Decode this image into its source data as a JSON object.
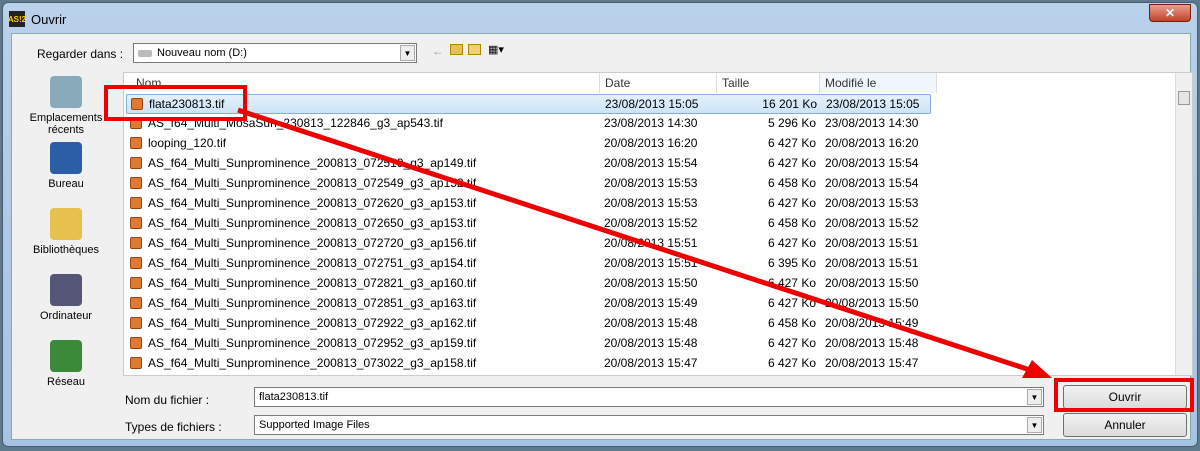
{
  "window": {
    "title": "Ouvrir",
    "logo": "AS!2",
    "close": "✕"
  },
  "lookin": {
    "label": "Regarder dans :",
    "value": "Nouveau nom (D:)"
  },
  "places": [
    {
      "label": "Emplacements récents",
      "icon": "recent-places-icon",
      "color": "#8ab"
    },
    {
      "label": "Bureau",
      "icon": "desktop-icon",
      "color": "#2a5fa8"
    },
    {
      "label": "Bibliothèques",
      "icon": "libraries-icon",
      "color": "#e8c050"
    },
    {
      "label": "Ordinateur",
      "icon": "computer-icon",
      "color": "#557"
    },
    {
      "label": "Réseau",
      "icon": "network-icon",
      "color": "#3a8a3a"
    }
  ],
  "columns": {
    "name": "Nom",
    "date": "Date",
    "size": "Taille",
    "modified": "Modifié le"
  },
  "files": [
    {
      "name": "flata230813.tif",
      "date": "23/08/2013 15:05",
      "size": "16 201 Ko",
      "modified": "23/08/2013 15:05",
      "selected": true
    },
    {
      "name": "AS_f64_Multi_MosaSun_230813_122846_g3_ap543.tif",
      "date": "23/08/2013 14:30",
      "size": "5 296 Ko",
      "modified": "23/08/2013 14:30"
    },
    {
      "name": "looping_120.tif",
      "date": "20/08/2013 16:20",
      "size": "6 427 Ko",
      "modified": "20/08/2013 16:20"
    },
    {
      "name": "AS_f64_Multi_Sunprominence_200813_072519_g3_ap149.tif",
      "date": "20/08/2013 15:54",
      "size": "6 427 Ko",
      "modified": "20/08/2013 15:54"
    },
    {
      "name": "AS_f64_Multi_Sunprominence_200813_072549_g3_ap152.tif",
      "date": "20/08/2013 15:53",
      "size": "6 458 Ko",
      "modified": "20/08/2013 15:54"
    },
    {
      "name": "AS_f64_Multi_Sunprominence_200813_072620_g3_ap153.tif",
      "date": "20/08/2013 15:53",
      "size": "6 427 Ko",
      "modified": "20/08/2013 15:53"
    },
    {
      "name": "AS_f64_Multi_Sunprominence_200813_072650_g3_ap153.tif",
      "date": "20/08/2013 15:52",
      "size": "6 458 Ko",
      "modified": "20/08/2013 15:52"
    },
    {
      "name": "AS_f64_Multi_Sunprominence_200813_072720_g3_ap156.tif",
      "date": "20/08/2013 15:51",
      "size": "6 427 Ko",
      "modified": "20/08/2013 15:51"
    },
    {
      "name": "AS_f64_Multi_Sunprominence_200813_072751_g3_ap154.tif",
      "date": "20/08/2013 15:51",
      "size": "6 395 Ko",
      "modified": "20/08/2013 15:51"
    },
    {
      "name": "AS_f64_Multi_Sunprominence_200813_072821_g3_ap160.tif",
      "date": "20/08/2013 15:50",
      "size": "6 427 Ko",
      "modified": "20/08/2013 15:50"
    },
    {
      "name": "AS_f64_Multi_Sunprominence_200813_072851_g3_ap163.tif",
      "date": "20/08/2013 15:49",
      "size": "6 427 Ko",
      "modified": "20/08/2013 15:50"
    },
    {
      "name": "AS_f64_Multi_Sunprominence_200813_072922_g3_ap162.tif",
      "date": "20/08/2013 15:48",
      "size": "6 458 Ko",
      "modified": "20/08/2013 15:49"
    },
    {
      "name": "AS_f64_Multi_Sunprominence_200813_072952_g3_ap159.tif",
      "date": "20/08/2013 15:48",
      "size": "6 427 Ko",
      "modified": "20/08/2013 15:48"
    },
    {
      "name": "AS_f64_Multi_Sunprominence_200813_073022_g3_ap158.tif",
      "date": "20/08/2013 15:47",
      "size": "6 427 Ko",
      "modified": "20/08/2013 15:47"
    }
  ],
  "filename": {
    "label": "Nom du fichier :",
    "value": "flata230813.tif"
  },
  "filetype": {
    "label": "Types de fichiers :",
    "value": "Supported Image Files"
  },
  "buttons": {
    "open": "Ouvrir",
    "cancel": "Annuler"
  },
  "annotation_color": "#e00000"
}
